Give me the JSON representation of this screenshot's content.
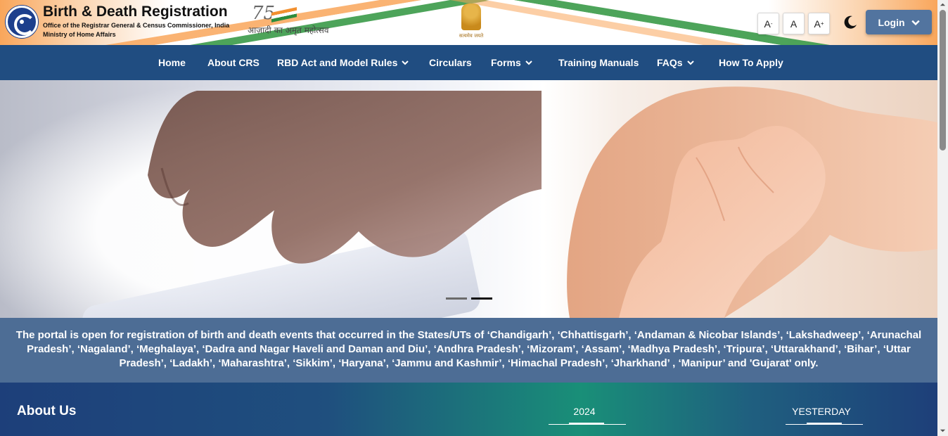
{
  "header": {
    "title": "Birth & Death Registration",
    "subtitle_line1": "Office of the Registrar General & Census Commissioner, India",
    "subtitle_line2": "Ministry of Home Affairs",
    "azadi_logo_text": "आज़ादी का अमृत महोत्सव",
    "emblem_motto": "सत्यमेव जयते",
    "font_controls": {
      "decrease": "A-",
      "normal": "A",
      "increase": "A+"
    },
    "login_label": "Login"
  },
  "nav": {
    "items": [
      {
        "label": "Home",
        "dropdown": false
      },
      {
        "label": "About CRS",
        "dropdown": false
      },
      {
        "label": "RBD Act and Model Rules",
        "dropdown": true
      },
      {
        "label": "Circulars",
        "dropdown": false
      },
      {
        "label": "Forms",
        "dropdown": true
      },
      {
        "label": "Training Manuals",
        "dropdown": false
      },
      {
        "label": "FAQs",
        "dropdown": true
      },
      {
        "label": "How To Apply",
        "dropdown": false
      }
    ]
  },
  "carousel": {
    "slide_count": 2,
    "active_index": 1
  },
  "notice": {
    "text": "The portal is open for registration of birth and death events that occurred in the States/UTs of ‘Chandigarh’, ‘Chhattisgarh’, ‘Andaman & Nicobar Islands’, ‘Lakshadweep’, ‘Arunachal Pradesh’, ‘Nagaland’, ‘Meghalaya’, ‘Dadra and Nagar Haveli and Daman and Diu’, ‘Andhra Pradesh’, ‘Mizoram’, ‘Assam’, ‘Madhya Pradesh’, ‘Tripura’, ‘Uttarakhand’, ‘Bihar’, ‘Uttar Pradesh’, ‘Ladakh’, ‘Maharashtra’, ‘Sikkim’, ‘Haryana’, ‘Jammu and Kashmir’, ‘Himachal Pradesh’, ‘Jharkhand’ , ‘Manipur’ and 'Gujarat' only."
  },
  "about": {
    "title": "About Us"
  },
  "stats": {
    "year_label": "2024",
    "yesterday_label": "YESTERDAY"
  },
  "colors": {
    "nav_bg": "#204d81",
    "login_bg": "#52749f",
    "notice_bg": "#4d6d95",
    "saffron": "#f2902f",
    "green": "#2c8c3c"
  },
  "icons": {
    "theme_toggle": "moon-icon",
    "dropdown": "chevron-down-icon"
  }
}
